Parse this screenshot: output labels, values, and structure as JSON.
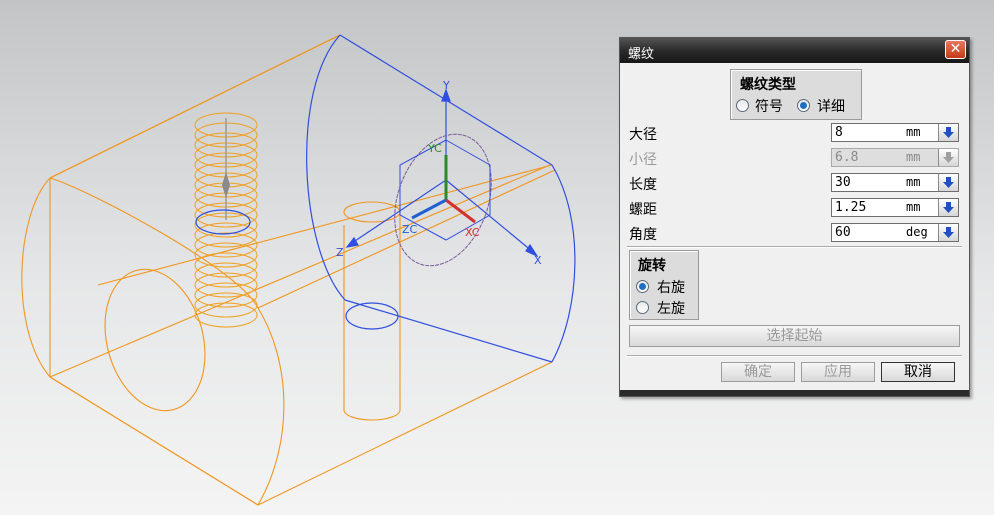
{
  "dialog": {
    "title": "螺纹",
    "close_icon": "close-icon"
  },
  "thread_type": {
    "title": "螺纹类型",
    "options": [
      {
        "label": "符号",
        "selected": false
      },
      {
        "label": "详细",
        "selected": true
      }
    ]
  },
  "params": [
    {
      "label": "大径",
      "value": "8",
      "unit": "mm",
      "enabled": true
    },
    {
      "label": "小径",
      "value": "6.8",
      "unit": "mm",
      "enabled": false
    },
    {
      "label": "长度",
      "value": "30",
      "unit": "mm",
      "enabled": true
    },
    {
      "label": "螺距",
      "value": "1.25",
      "unit": "mm",
      "enabled": true
    },
    {
      "label": "角度",
      "value": "60",
      "unit": "deg",
      "enabled": true
    }
  ],
  "rotation": {
    "title": "旋转",
    "options": [
      {
        "label": "右旋",
        "selected": true
      },
      {
        "label": "左旋",
        "selected": false
      }
    ]
  },
  "buttons": {
    "select_start": "选择起始",
    "ok": "确定",
    "apply": "应用",
    "cancel": "取消"
  },
  "viewport": {
    "axis_labels": {
      "y": "Y",
      "x": "X",
      "z": "Z",
      "yc": "YC",
      "xc": "XC",
      "zc": "ZC"
    },
    "colors": {
      "part": "#f0961e",
      "datum": "#2f4fe0",
      "thread": "#f0a020"
    }
  }
}
